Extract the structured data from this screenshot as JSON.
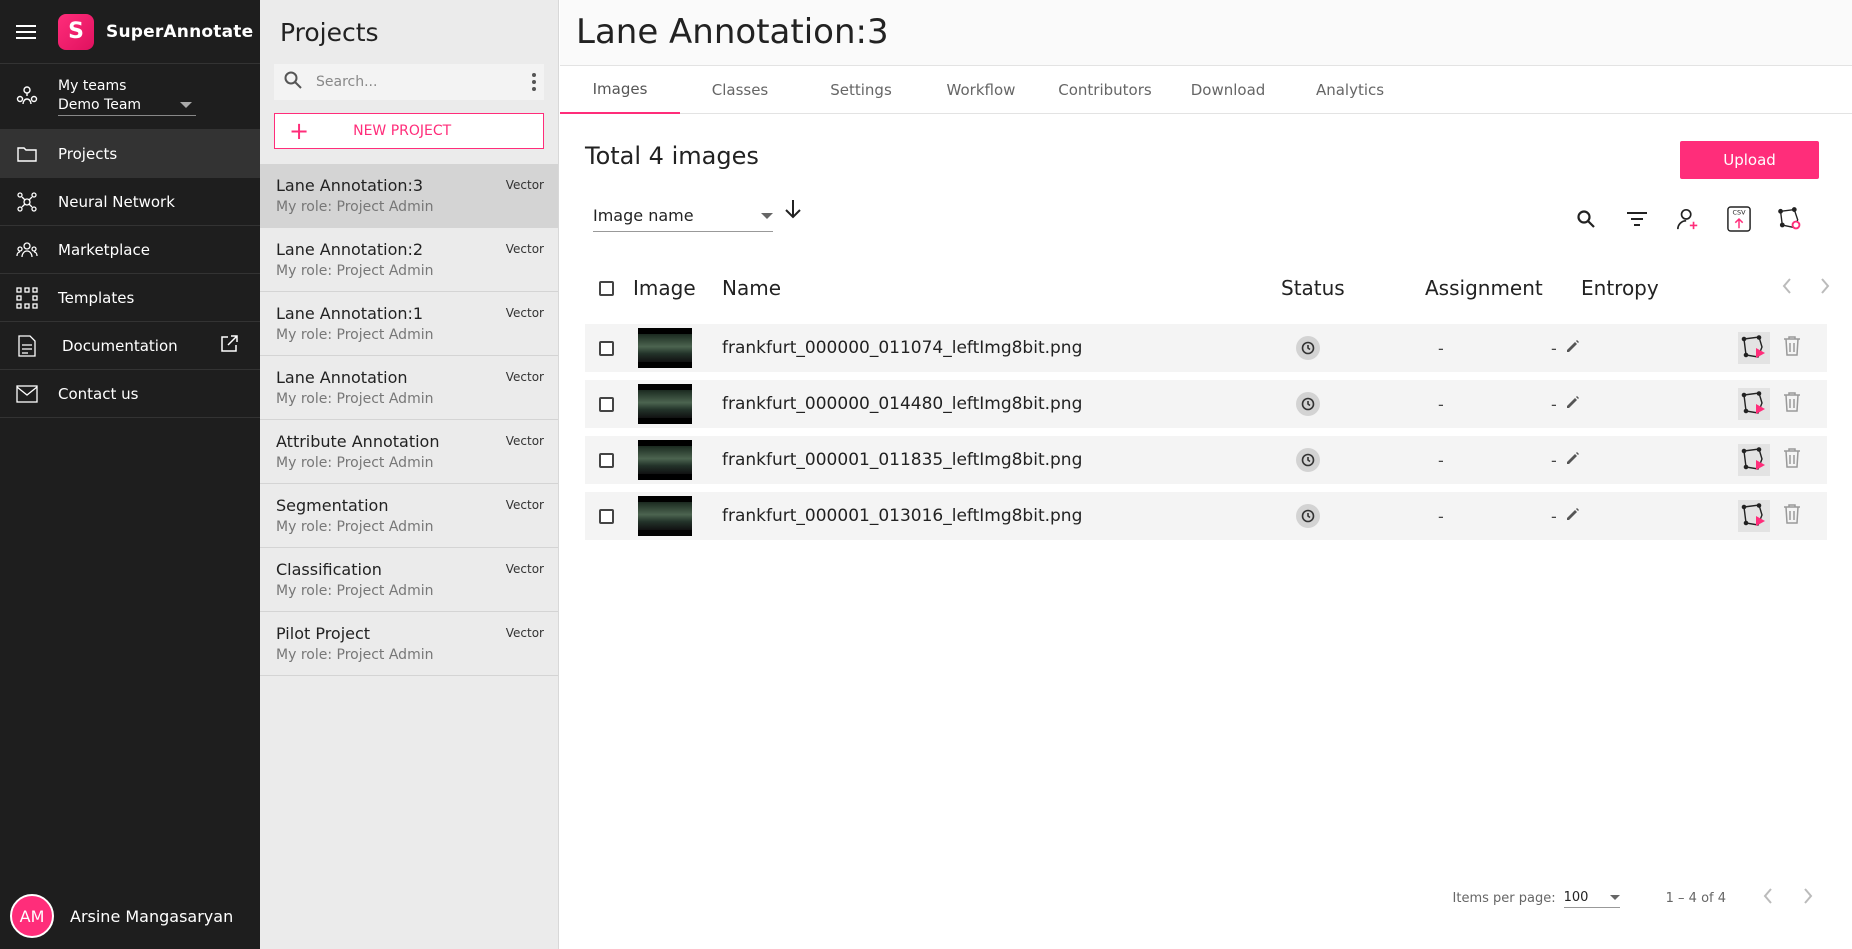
{
  "app": {
    "brand": "SuperAnnotate",
    "logo_letter": "S",
    "accent": "#ff2d7a"
  },
  "sidebar": {
    "teams_label": "My teams",
    "team_value": "Demo Team",
    "items": [
      {
        "label": "Projects",
        "icon": "folder-icon",
        "active": true
      },
      {
        "label": "Neural Network",
        "icon": "neural-network-icon"
      },
      {
        "label": "Marketplace",
        "icon": "marketplace-icon"
      },
      {
        "label": "Templates",
        "icon": "templates-icon"
      },
      {
        "label": "Documentation",
        "icon": "documentation-icon"
      },
      {
        "label": "Contact us",
        "icon": "mail-icon"
      }
    ],
    "user": {
      "initials": "AM",
      "name": "Arsine Mangasaryan"
    }
  },
  "projects": {
    "title": "Projects",
    "search_placeholder": "Search...",
    "new_project": "NEW PROJECT",
    "list": [
      {
        "name": "Lane Annotation:3",
        "role": "My role: Project Admin",
        "type": "Vector"
      },
      {
        "name": "Lane Annotation:2",
        "role": "My role: Project Admin",
        "type": "Vector"
      },
      {
        "name": "Lane Annotation:1",
        "role": "My role: Project Admin",
        "type": "Vector"
      },
      {
        "name": "Lane Annotation",
        "role": "My role: Project Admin",
        "type": "Vector"
      },
      {
        "name": "Attribute Annotation",
        "role": "My role: Project Admin",
        "type": "Vector"
      },
      {
        "name": "Segmentation",
        "role": "My role: Project Admin",
        "type": "Vector"
      },
      {
        "name": "Classification",
        "role": "My role: Project Admin",
        "type": "Vector"
      },
      {
        "name": "Pilot Project",
        "role": "My role: Project Admin",
        "type": "Vector"
      }
    ]
  },
  "main": {
    "title": "Lane Annotation:3",
    "tabs": [
      {
        "label": "Images",
        "active": true
      },
      {
        "label": "Classes"
      },
      {
        "label": "Settings"
      },
      {
        "label": "Workflow"
      },
      {
        "label": "Contributors"
      },
      {
        "label": "Download"
      },
      {
        "label": "Analytics"
      }
    ],
    "total": "Total 4 images",
    "upload": "Upload",
    "sort_by": "Image name",
    "columns": {
      "image": "Image",
      "name": "Name",
      "status": "Status",
      "assignment": "Assignment",
      "entropy": "Entropy"
    },
    "rows": [
      {
        "name": "frankfurt_000000_011074_leftImg8bit.png",
        "assignment": "-",
        "entropy": "-"
      },
      {
        "name": "frankfurt_000000_014480_leftImg8bit.png",
        "assignment": "-",
        "entropy": "-"
      },
      {
        "name": "frankfurt_000001_011835_leftImg8bit.png",
        "assignment": "-",
        "entropy": "-"
      },
      {
        "name": "frankfurt_000001_013016_leftImg8bit.png",
        "assignment": "-",
        "entropy": "-"
      }
    ],
    "pager": {
      "items_per_page_label": "Items per page:",
      "items_per_page": "100",
      "range": "1 – 4 of 4"
    }
  }
}
